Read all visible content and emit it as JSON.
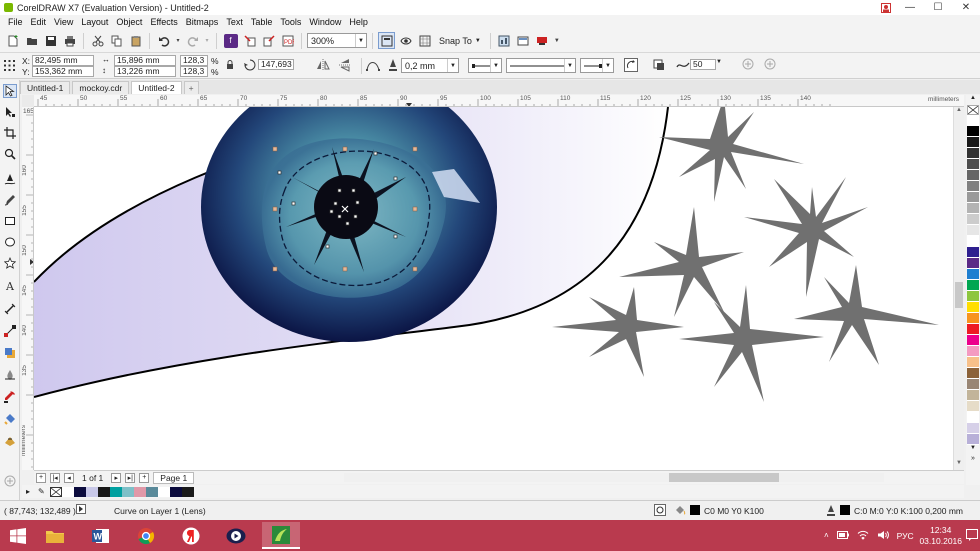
{
  "window": {
    "title": "CorelDRAW X7 (Evaluation Version) - Untitled-2",
    "controls": [
      "—",
      "☐",
      "✕"
    ]
  },
  "menu": [
    "File",
    "Edit",
    "View",
    "Layout",
    "Object",
    "Effects",
    "Bitmaps",
    "Text",
    "Table",
    "Tools",
    "Window",
    "Help"
  ],
  "std_toolbar": {
    "zoom": "300%",
    "snap_label": "Snap To"
  },
  "property_bar": {
    "x_label": "X:",
    "x": "82,495 mm",
    "y_label": "Y:",
    "y": "153,362 mm",
    "w": "15,896 mm",
    "h": "13,226 mm",
    "scale_w": "128,3",
    "scale_h": "128,3",
    "pct": "%",
    "angle": "147,693",
    "outline_width": "0,2 mm",
    "smooth_value": "50"
  },
  "tabs": [
    "Untitled-1",
    "mockoy.cdr",
    "Untitled-2",
    "+"
  ],
  "ruler": {
    "h_ticks": [
      "45",
      "50",
      "55",
      "60",
      "65",
      "70",
      "75",
      "80",
      "85",
      "90",
      "95",
      "100",
      "105",
      "110",
      "115",
      "120",
      "125",
      "130",
      "135",
      "140"
    ],
    "unit": "millimeters",
    "v_ticks": [
      "165",
      "160",
      "155",
      "150",
      "145",
      "140",
      "135"
    ]
  },
  "navigator": {
    "page_count": "1 of 1",
    "page_tab": "Page 1"
  },
  "colors": {
    "palette": [
      "#ffffff",
      "#000000",
      "#1a1a1a",
      "#333333",
      "#4d4d4d",
      "#666666",
      "#808080",
      "#999999",
      "#b3b3b3",
      "#cccccc",
      "#e6e6e6",
      "#ffffff",
      "#2e1f8f",
      "#5b2a86",
      "#1e7fd0",
      "#00a651",
      "#8dc63f",
      "#ffde00",
      "#f7941d",
      "#ed1c24",
      "#ec008c",
      "#f49ac1",
      "#f7c08a",
      "#8c6239",
      "#998675",
      "#c2b49a",
      "#e6dcc8",
      "#ffffff",
      "#d6d0e8",
      "#b8b0d8"
    ],
    "doc_palette": [
      "#ffffff",
      "#0b0b3d",
      "#c8c8e8",
      "#1a1a1a",
      "#00a0a0",
      "#7ec0c8",
      "#e098a8",
      "#5a8a9a",
      "#ffffff",
      "#0b0b3d",
      "#1a1a1a"
    ],
    "star_fill": "#707070",
    "iris_dark": "#0e1a4d",
    "iris_teal": "#4b8fa6",
    "sclera": "#ddd8f2"
  },
  "status": {
    "coords": "( 87,743; 132,489 )",
    "object_info": "Curve on Layer 1  (Lens)",
    "fill_info": "C0 M0 Y0 K100",
    "outline_info": "C:0 M:0 Y:0 K:100  0,200 mm"
  },
  "taskbar": {
    "apps": [
      "file-explorer",
      "word",
      "chrome",
      "yandex",
      "media-player",
      "coreldraw"
    ],
    "lang": "РУС",
    "time": "12:34",
    "date": "03.10.2016"
  }
}
